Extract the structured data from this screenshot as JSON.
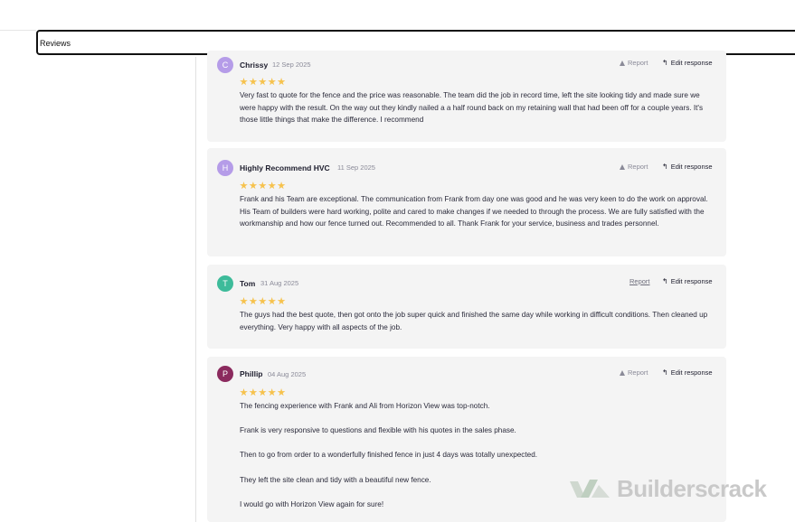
{
  "header": {
    "tab_label": "Reviews"
  },
  "reviews": [
    {
      "initial": "C",
      "avatar_color": "#b59ce8",
      "name": "Chrissy",
      "date": "12 Sep 2025",
      "rating": 5,
      "report_label": "Report",
      "edit_label": "Edit response",
      "paragraphs": [
        "Very fast to quote for the fence and the price was reasonable. The team did the job in record time, left the site looking tidy and made sure we were happy with the result. On the way out they kindly nailed a a half round back on my retaining wall that had been off for a couple years. It's those little things that make the difference. I recommend"
      ]
    },
    {
      "initial": "H",
      "avatar_color": "#b59ce8",
      "name": "Highly Recommend HVC",
      "date": "11 Sep 2025",
      "rating": 5,
      "report_label": "Report",
      "edit_label": "Edit response",
      "paragraphs": [
        "Frank and his Team are exceptional. The communication from Frank from day one was good and he was very keen to do the work on approval. His Team of builders were hard working, polite and cared to make changes if we needed to through the process. We are fully satisfied with the workmanship and how our fence turned out. Recommended to all. Thank Frank for your service, business and trades personnel."
      ]
    },
    {
      "initial": "T",
      "avatar_color": "#3dbb9a",
      "name": "Tom",
      "date": "31 Aug 2025",
      "rating": 5,
      "report_label": "Report",
      "edit_label": "Edit response",
      "paragraphs": [
        "The guys had the best quote, then got onto the job super quick and finished the same day while working in difficult conditions. Then cleaned up everything. Very happy with all aspects of the job."
      ]
    },
    {
      "initial": "P",
      "avatar_color": "#8b2a5e",
      "name": "Phillip",
      "date": "04 Aug 2025",
      "rating": 5,
      "report_label": "Report",
      "edit_label": "Edit response",
      "paragraphs": [
        "The fencing experience with Frank and Ali from Horizon View was top-notch.",
        "Frank is very responsive to questions and flexible with his quotes in the sales phase.",
        "Then to go from order to a wonderfully finished fence in just 4 days was totally unexpected.",
        "They left the site clean and tidy with a beautiful new fence.",
        "I would go with Horizon View again for sure!"
      ]
    }
  ],
  "branding": {
    "logo_text": "Builderscrack"
  }
}
